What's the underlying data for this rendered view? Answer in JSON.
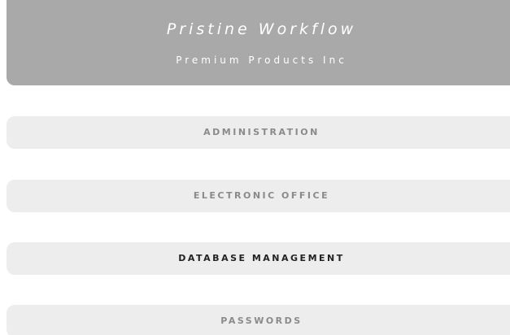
{
  "header": {
    "title": "Pristine Workflow",
    "subtitle": "Premium Products Inc"
  },
  "menu": {
    "items": [
      {
        "label": "ADMINISTRATION",
        "active": false
      },
      {
        "label": "ELECTRONIC OFFICE",
        "active": false
      },
      {
        "label": "DATABASE MANAGEMENT",
        "active": true
      },
      {
        "label": "PASSWORDS",
        "active": false
      }
    ]
  },
  "colors": {
    "header_bg": "#a9a9a9",
    "item_bg": "#ededed",
    "label_inactive": "#8a8a8a",
    "label_active": "#222222"
  }
}
